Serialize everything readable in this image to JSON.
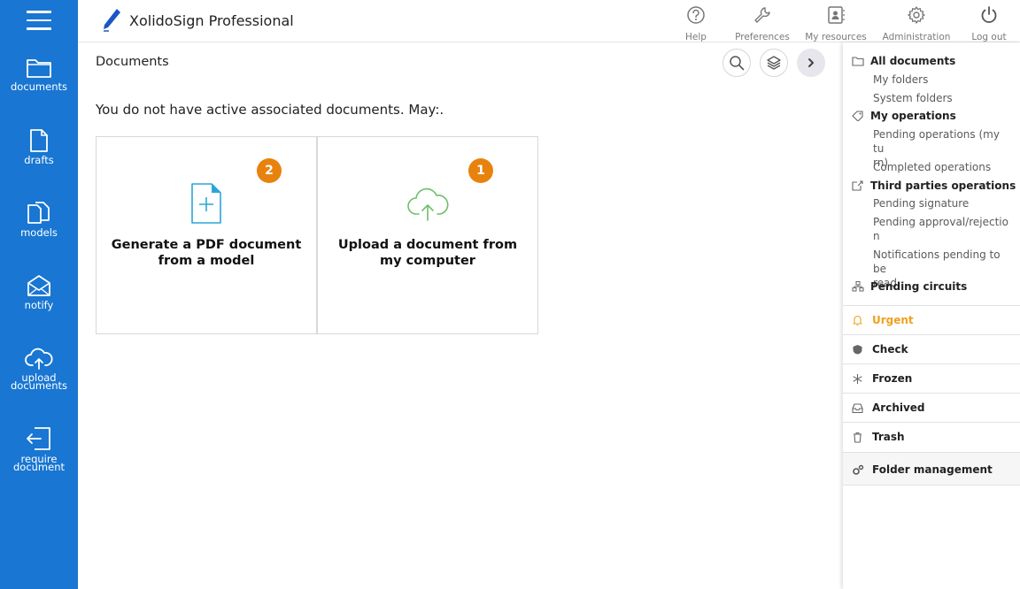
{
  "app": {
    "title": "XolidoSign Professional"
  },
  "header_buttons": [
    {
      "label": "Help",
      "icon": "help-icon"
    },
    {
      "label": "Preferences",
      "icon": "wrench-icon"
    },
    {
      "label": "My resources",
      "icon": "contacts-icon"
    },
    {
      "label": "Administration",
      "icon": "gear-icon"
    },
    {
      "label": "Log out",
      "icon": "power-icon"
    }
  ],
  "sidebar": {
    "items": [
      {
        "label": "documents",
        "icon": "folder-icon"
      },
      {
        "label": "drafts",
        "icon": "file-icon"
      },
      {
        "label": "models",
        "icon": "copy-files-icon"
      },
      {
        "label": "notify",
        "icon": "envelope-icon"
      },
      {
        "label_line1": "upload",
        "label_line2": "documents",
        "icon": "cloud-upload-icon"
      },
      {
        "label_line1": "require",
        "label_line2": "document",
        "icon": "sign-in-icon"
      }
    ]
  },
  "main": {
    "page_title": "Documents",
    "message": "You do not have active associated documents. May:.",
    "cards": [
      {
        "badge": "2",
        "line1": "Generate a PDF document",
        "line2": "from a model",
        "icon": "new-pdf-icon"
      },
      {
        "badge": "1",
        "line1": "Upload a document from",
        "line2": "my computer",
        "icon": "cloud-upload-icon"
      }
    ]
  },
  "right_panel": {
    "all_documents": "All documents",
    "my_folders": "My folders",
    "system_folders": "System folders",
    "my_operations": "My operations",
    "pending_ops_l1": "Pending operations (my tu",
    "pending_ops_l2": "rn)",
    "completed_ops": "Completed operations",
    "third_parties": "Third parties operations",
    "pending_signature": "Pending signature",
    "pending_approval_l1": "Pending approval/rejectio",
    "pending_approval_l2": "n",
    "notifications_l1": "Notifications pending to be",
    "notifications_l2": "read",
    "pending_circuits": "Pending circuits",
    "urgent": "Urgent",
    "check": "Check",
    "frozen": "Frozen",
    "archived": "Archived",
    "trash": "Trash",
    "folder_management": "Folder management"
  },
  "colors": {
    "sidebar": "#1976d2",
    "badge": "#e8820e",
    "urgent": "#f0a020",
    "pdf_icon": "#2aa6d6",
    "upload_icon": "#6cc06c"
  }
}
